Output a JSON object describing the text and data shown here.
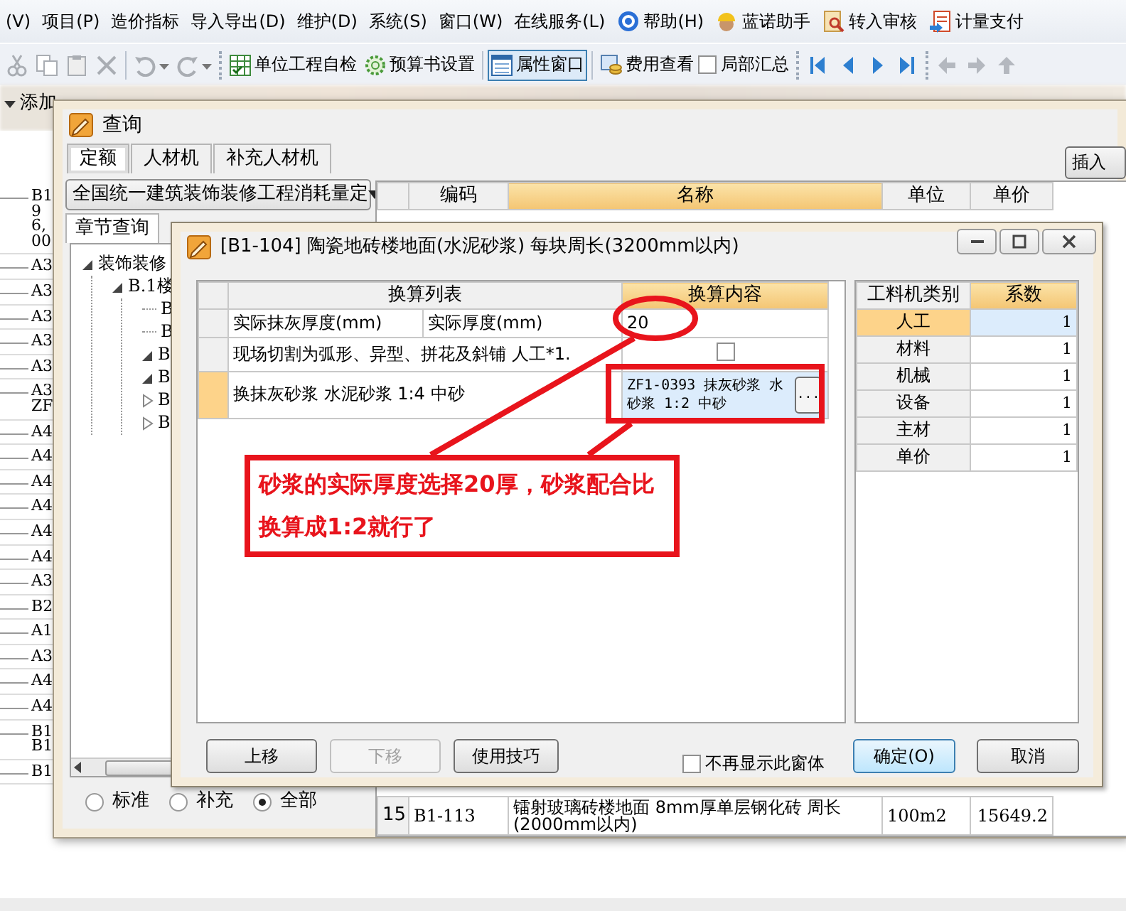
{
  "menu_bar": {
    "items": [
      {
        "label": "(V)",
        "kind": "plain"
      },
      {
        "label": "项目(P)",
        "kind": "plain"
      },
      {
        "label": "造价指标",
        "kind": "plain"
      },
      {
        "label": "导入导出(D)",
        "kind": "plain"
      },
      {
        "label": "维护(D)",
        "kind": "plain"
      },
      {
        "label": "系统(S)",
        "kind": "plain"
      },
      {
        "label": "窗口(W)",
        "kind": "plain"
      },
      {
        "label": "在线服务(L)",
        "kind": "plain"
      },
      {
        "label": "帮助(H)",
        "kind": "help"
      },
      {
        "label": "蓝诺助手",
        "kind": "assistant"
      },
      {
        "label": "转入审核",
        "kind": "review"
      },
      {
        "label": "计量支付",
        "kind": "payment"
      }
    ]
  },
  "toolbar": {
    "items": [
      {
        "kind": "cut",
        "disabled": true
      },
      {
        "kind": "copy",
        "disabled": true
      },
      {
        "kind": "paste",
        "disabled": true
      },
      {
        "kind": "delete",
        "disabled": true
      },
      {
        "kind": "undo",
        "disabled": true
      },
      {
        "kind": "redo",
        "disabled": true
      },
      {
        "kind": "selfcheck",
        "label": "单位工程自检",
        "pressed": false
      },
      {
        "kind": "settings",
        "label": "预算书设置",
        "pressed": false
      },
      {
        "kind": "window",
        "label": "属性窗口",
        "pressed": true
      },
      {
        "kind": "fees",
        "label": "费用查看",
        "pressed": false
      },
      {
        "kind": "checkbox",
        "label": "局部汇总",
        "checked": false
      },
      {
        "kind": "first",
        "disabled": false
      },
      {
        "kind": "prev",
        "disabled": false
      },
      {
        "kind": "next",
        "disabled": false
      },
      {
        "kind": "last",
        "disabled": false
      },
      {
        "kind": "back",
        "disabled": true
      },
      {
        "kind": "forward",
        "disabled": true
      },
      {
        "kind": "up",
        "disabled": true
      }
    ]
  },
  "sub_toolbar": {
    "label": "添加"
  },
  "code_list": [
    {
      "lines": [
        "B1",
        "9",
        "6,",
        "00"
      ]
    },
    {
      "lines": [
        "A3"
      ]
    },
    {
      "lines": [
        "A3"
      ]
    },
    {
      "lines": [
        "A3"
      ]
    },
    {
      "lines": [
        "A3"
      ]
    },
    {
      "lines": [
        "A3"
      ]
    },
    {
      "lines": [
        "A3",
        "ZF"
      ]
    },
    {
      "lines": [
        "A4"
      ]
    },
    {
      "lines": [
        "A4"
      ]
    },
    {
      "lines": [
        "A4"
      ]
    },
    {
      "lines": [
        "A4"
      ]
    },
    {
      "lines": [
        "A4"
      ]
    },
    {
      "lines": [
        "A4"
      ]
    },
    {
      "lines": [
        "A3"
      ]
    },
    {
      "lines": [
        "B2"
      ]
    },
    {
      "lines": [
        "A1"
      ]
    },
    {
      "lines": [
        "A3"
      ]
    },
    {
      "lines": [
        "A4"
      ]
    },
    {
      "lines": [
        "A4"
      ]
    },
    {
      "lines": [
        "B1",
        "B1"
      ]
    },
    {
      "lines": [
        "B1"
      ]
    }
  ],
  "query_window": {
    "title": "查询",
    "tabs": [
      {
        "label": "定额",
        "selected": true
      },
      {
        "label": "人材机",
        "selected": false
      },
      {
        "label": "补充人材机",
        "selected": false
      }
    ],
    "insert_button": "插入",
    "library": "全国统一建筑装饰装修工程消耗量定",
    "panel_tabs": [
      {
        "label": "章节查询",
        "selected": true
      }
    ],
    "tree": [
      {
        "label": "装饰装修",
        "expanded": true,
        "children": [
          {
            "label": "B.1楼",
            "expanded": true,
            "children": [
              {
                "label": "B"
              },
              {
                "label": "B"
              },
              {
                "label": "B",
                "expanded": true
              },
              {
                "label": "B",
                "expanded": true
              },
              {
                "label": "B",
                "expanded": false
              },
              {
                "label": "B",
                "expanded": false
              }
            ]
          }
        ]
      }
    ],
    "filter": [
      {
        "label": "标准",
        "selected": false
      },
      {
        "label": "补充",
        "selected": false
      },
      {
        "label": "全部",
        "selected": true
      }
    ],
    "table": {
      "columns": [
        {
          "label": "编码",
          "selected": false
        },
        {
          "label": "名称",
          "selected": true
        },
        {
          "label": "单位",
          "selected": false
        },
        {
          "label": "单价",
          "selected": false
        }
      ],
      "rows": [
        {
          "index": "15",
          "code": "B1-113",
          "name": "镭射玻璃砖楼地面 8mm厚单层钢化砖 周长(2000mm以内)",
          "unit": "100m2",
          "price": "15649.2"
        }
      ]
    }
  },
  "dialog": {
    "title": "[B1-104]  陶瓷地砖楼地面(水泥砂浆) 每块周长(3200mm以内)",
    "conversion": {
      "columns": [
        {
          "label": "换算列表",
          "selected": false
        },
        {
          "label": "换算内容",
          "selected": true
        }
      ],
      "rows": [
        {
          "kind": "value",
          "label": "实际抹灰厚度(mm)",
          "sublabel": "实际厚度(mm)",
          "value": "20",
          "selected": false
        },
        {
          "kind": "checkbox",
          "label": "现场切割为弧形、异型、拼花及斜铺 人工*1.",
          "checked": false,
          "selected": false
        },
        {
          "kind": "picker",
          "label": "换抹灰砂浆 水泥砂浆 1:4 中砂",
          "value_lines": [
            "ZF1-0393  抹灰砂浆 水",
            "砂浆 1:2 中砂"
          ],
          "button": "...",
          "selected": true
        }
      ]
    },
    "factors": {
      "columns": [
        {
          "label": "工料机类别",
          "selected": false
        },
        {
          "label": "系数",
          "selected": true
        }
      ],
      "rows": [
        {
          "category": "人工",
          "factor": "1",
          "selected": true
        },
        {
          "category": "材料",
          "factor": "1",
          "selected": false
        },
        {
          "category": "机械",
          "factor": "1",
          "selected": false
        },
        {
          "category": "设备",
          "factor": "1",
          "selected": false
        },
        {
          "category": "主材",
          "factor": "1",
          "selected": false
        },
        {
          "category": "单价",
          "factor": "1",
          "selected": false
        }
      ]
    },
    "left_buttons": [
      {
        "label": "上移",
        "disabled": false
      },
      {
        "label": "下移",
        "disabled": true
      },
      {
        "label": "使用技巧",
        "disabled": false
      }
    ],
    "dont_show": {
      "label": "不再显示此窗体",
      "checked": false
    },
    "right_buttons": [
      {
        "label": "确定(O)",
        "default": true
      },
      {
        "label": "取消",
        "default": false
      }
    ]
  },
  "annotation": {
    "text": "砂浆的实际厚度选择20厚，砂浆配合比换算成1:2就行了"
  }
}
